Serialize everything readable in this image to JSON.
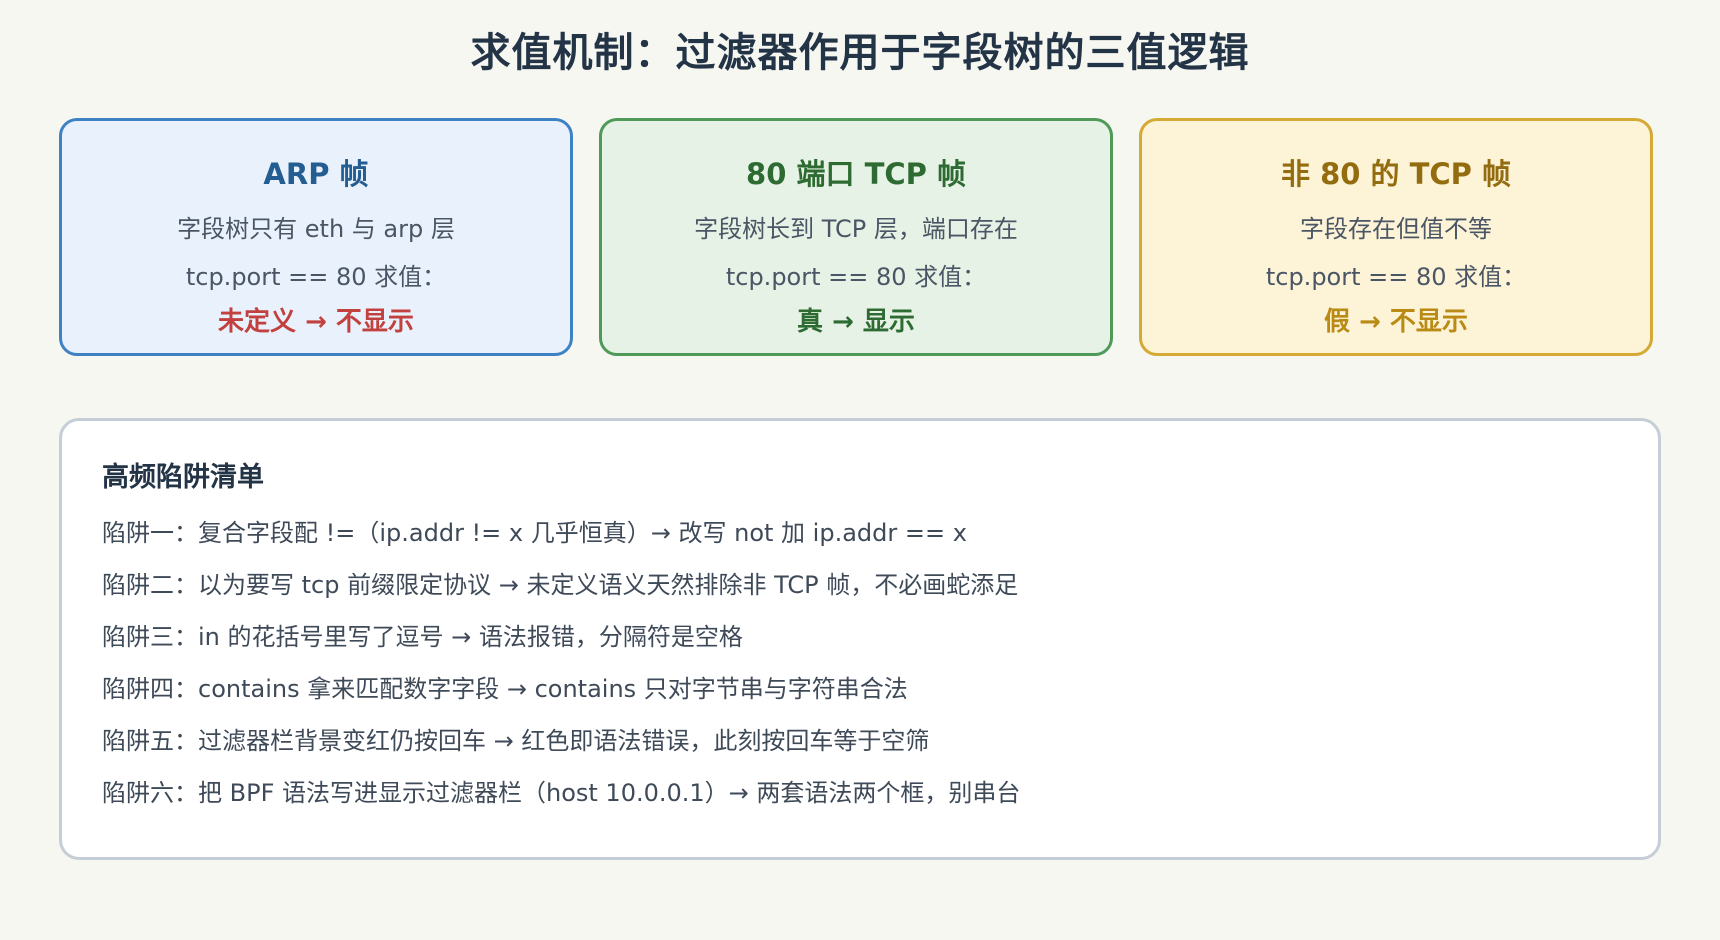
{
  "page": {
    "title": "求值机制：过滤器作用于字段树的三值逻辑"
  },
  "cards": [
    {
      "title": "ARP 帧",
      "description": "字段树只有 eth 与 arp 层",
      "evaluation": "tcp.port == 80 求值：",
      "result": "未定义 → 不显示",
      "accent_color": "#3f82c4",
      "background_color": "#e9f2fc",
      "result_color": "#c2413f"
    },
    {
      "title": "80 端口 TCP 帧",
      "description": "字段树长到 TCP 层，端口存在",
      "evaluation": "tcp.port == 80 求值：",
      "result": "真 → 显示",
      "accent_color": "#4f9a58",
      "background_color": "#e6f2e5",
      "result_color": "#2e6b33"
    },
    {
      "title": "非 80 的 TCP 帧",
      "description": "字段存在但值不等",
      "evaluation": "tcp.port == 80 求值：",
      "result": "假 → 不显示",
      "accent_color": "#d4aa34",
      "background_color": "#fdf3d6",
      "result_color": "#b98a14"
    }
  ],
  "pitfalls": {
    "title": "高频陷阱清单",
    "items": [
      "陷阱一：复合字段配 !=（ip.addr != x 几乎恒真）→ 改写 not 加 ip.addr == x",
      "陷阱二：以为要写 tcp 前缀限定协议 → 未定义语义天然排除非 TCP 帧，不必画蛇添足",
      "陷阱三：in 的花括号里写了逗号 → 语法报错，分隔符是空格",
      "陷阱四：contains 拿来匹配数字字段 → contains 只对字节串与字符串合法",
      "陷阱五：过滤器栏背景变红仍按回车 → 红色即语法错误，此刻按回车等于空筛",
      "陷阱六：把 BPF 语法写进显示过滤器栏（host 10.0.0.1）→ 两套语法两个框，别串台"
    ]
  }
}
